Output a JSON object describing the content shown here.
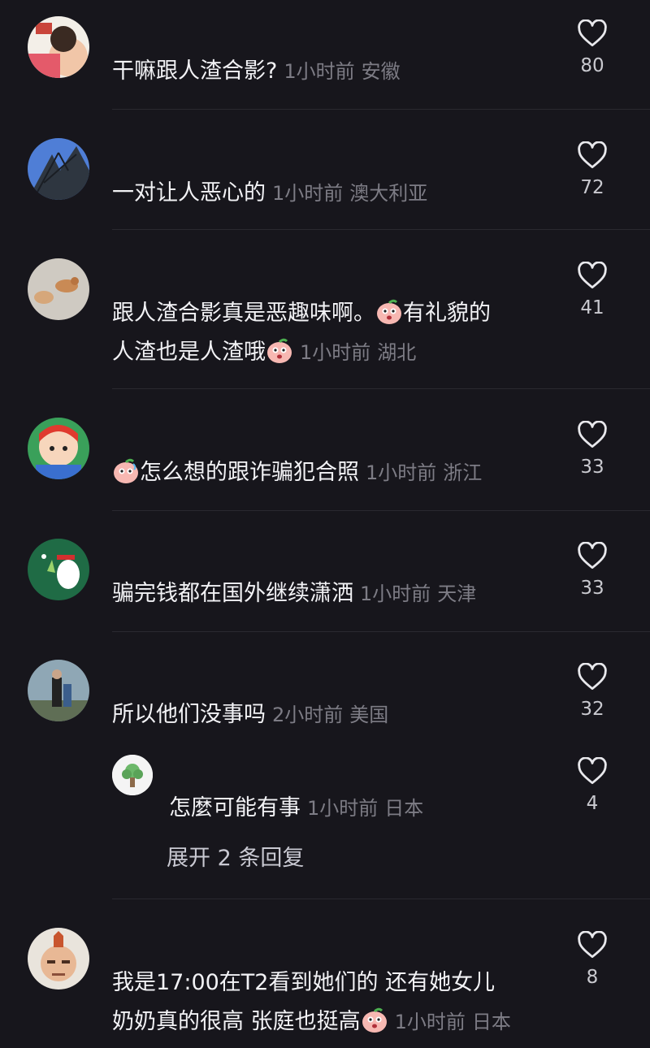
{
  "comments": [
    {
      "text": "干嘛跟人渣合影?",
      "time": "1小时前",
      "location": "安徽",
      "likes": "80"
    },
    {
      "text": "一对让人恶心的",
      "time": "1小时前",
      "location": "澳大利亚",
      "likes": "72"
    },
    {
      "text_a": "跟人渣合影真是恶趣味啊。",
      "text_b": "有礼貌的",
      "text_c": "人渣也是人渣哦",
      "time": "1小时前",
      "location": "湖北",
      "likes": "41"
    },
    {
      "text": "怎么想的跟诈骗犯合照",
      "time": "1小时前",
      "location": "浙江",
      "likes": "33"
    },
    {
      "text": "骗完钱都在国外继续潇洒",
      "time": "1小时前",
      "location": "天津",
      "likes": "33"
    },
    {
      "text": "所以他们没事吗",
      "time": "2小时前",
      "location": "美国",
      "likes": "32"
    },
    {
      "text_a": "我是17:00在T2看到她们的 还有她女儿",
      "text_b": "奶奶真的很高 张庭也挺高",
      "time": "1小时前",
      "location": "日本",
      "likes": "8"
    }
  ],
  "reply": {
    "text": "怎麼可能有事",
    "time": "1小时前",
    "location": "日本",
    "likes": "4"
  },
  "expand_replies": "展开 2 条回复",
  "icons": {
    "like": "heart-outline-icon",
    "emoji": "peach-face-emoji"
  },
  "colors": {
    "background": "#17161c",
    "text": "#f2f2f5",
    "meta": "#7d7c85"
  }
}
